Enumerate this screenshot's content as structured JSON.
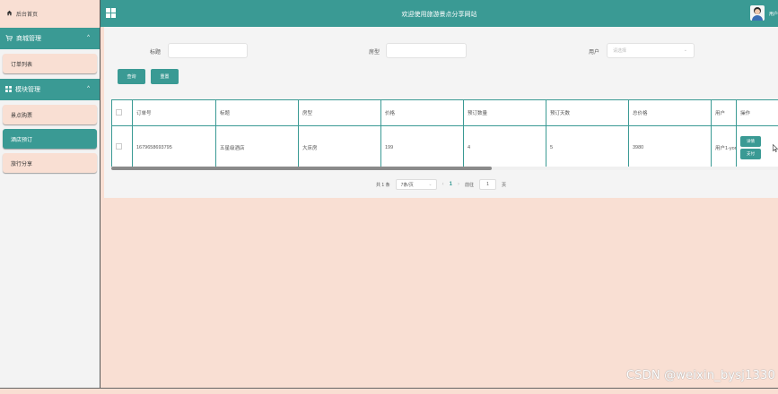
{
  "header": {
    "title": "欢迎使用旅游景点分享网站",
    "user_label": "用户"
  },
  "sidebar": {
    "home": "后台首页",
    "groups": [
      {
        "label": "商城管理",
        "items": [
          {
            "label": "订单列表",
            "active": false
          }
        ]
      },
      {
        "label": "模块管理",
        "items": [
          {
            "label": "景点购票",
            "active": false
          },
          {
            "label": "酒店预订",
            "active": true
          },
          {
            "label": "旅行分享",
            "active": false
          }
        ]
      }
    ]
  },
  "filters": {
    "title_label": "标题",
    "title_value": "",
    "room_label": "房型",
    "room_value": "",
    "user_label": "用户",
    "user_placeholder": "请选择"
  },
  "buttons": {
    "search": "查询",
    "reset": "重置"
  },
  "table": {
    "columns": [
      "",
      "订单号",
      "标题",
      "房型",
      "价格",
      "预订数量",
      "预订天数",
      "总价格",
      "用户",
      "操作"
    ],
    "rows": [
      {
        "order_no": "1679658693795",
        "title": "五星级酒店",
        "room": "大床房",
        "price": "199",
        "quantity": "4",
        "days": "5",
        "total": "3980",
        "user": "用户1-yong",
        "actions": [
          "详情",
          "支付"
        ]
      }
    ]
  },
  "pagination": {
    "total_text": "共 1 条",
    "page_size": "7条/页",
    "current_page": "1",
    "goto_label": "前往",
    "goto_value": "1",
    "page_suffix": "页"
  },
  "watermark": "CSDN @weixin_bysj1330",
  "colors": {
    "accent": "#3a9a94",
    "background": "#f9dfd3",
    "panel": "#f4f4f4",
    "sidebar": "#f3f3f3"
  }
}
